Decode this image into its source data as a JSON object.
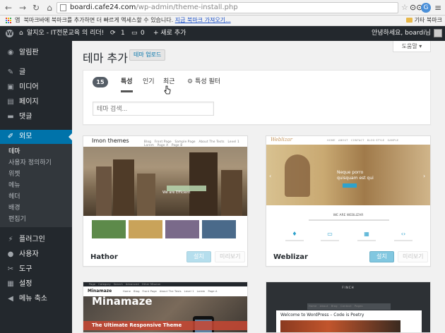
{
  "browser": {
    "back_icon": "back-arrow-icon",
    "forward_icon": "forward-arrow-icon",
    "reload_icon": "reload-icon",
    "home_icon": "home-icon",
    "url_host": "boardi.cafe24.com",
    "url_path": "/wp-admin/theme-install.php",
    "bookmark_bar": {
      "apps_label": "앱",
      "prompt": "북마크바에 북마크를 추가하면 더 빠르게 액세스할 수 있습니다.",
      "import_link": "지금 북마크 가져오기...",
      "other_bookmarks": "기타 북마크"
    }
  },
  "adminbar": {
    "site_name": "알지오 - IT전문교육 의 리더!",
    "updates_count": "1",
    "comments_count": "0",
    "new_label": "+ 새로 추가",
    "greeting": "안녕하세요, boardi님"
  },
  "sidebar": {
    "items": [
      {
        "label": "알림판",
        "icon": "dashboard-icon"
      },
      {
        "label": "글",
        "icon": "pin-icon"
      },
      {
        "label": "미디어",
        "icon": "media-icon"
      },
      {
        "label": "페이지",
        "icon": "page-icon"
      },
      {
        "label": "댓글",
        "icon": "comment-icon"
      },
      {
        "label": "외모",
        "icon": "brush-icon"
      },
      {
        "label": "플러그인",
        "icon": "plugin-icon"
      },
      {
        "label": "사용자",
        "icon": "user-icon"
      },
      {
        "label": "도구",
        "icon": "wrench-icon"
      },
      {
        "label": "설정",
        "icon": "settings-icon"
      },
      {
        "label": "메뉴 축소",
        "icon": "collapse-icon"
      }
    ],
    "submenu": [
      "테마",
      "사용자 정의하기",
      "위젯",
      "메뉴",
      "헤더",
      "배경",
      "편집기"
    ]
  },
  "main": {
    "title": "테마 추가",
    "upload_button": "테마 업로드",
    "help_tab": "도움말 ▾",
    "filter": {
      "count": "15",
      "tabs": [
        "특성",
        "인기",
        "최근",
        "특성 필터"
      ],
      "search_placeholder": "테마 검색..."
    },
    "themes": [
      {
        "name": "Hathor",
        "install": "설치",
        "preview": "미리보기",
        "logo": "Imon themes",
        "caption": "We are Efficient"
      },
      {
        "name": "Weblizar",
        "install": "설치",
        "preview": "미리보기",
        "logo": "Weblizar",
        "hero_line1": "Neque porro",
        "hero_line2": "quisquam est qui",
        "we_are": "WE ARE WEBLIZAR"
      },
      {
        "logo": "Minamaze",
        "headline": "Minamaze",
        "subheadline": "The Ultimate Responsive Theme"
      },
      {
        "logo": "FINCH",
        "post_title": "Welcome to WordPress – Code is Poetry"
      }
    ]
  },
  "colors": {
    "admin_bar": "#23282d",
    "accent": "#0073aa",
    "page_bg": "#f1f1f1"
  }
}
